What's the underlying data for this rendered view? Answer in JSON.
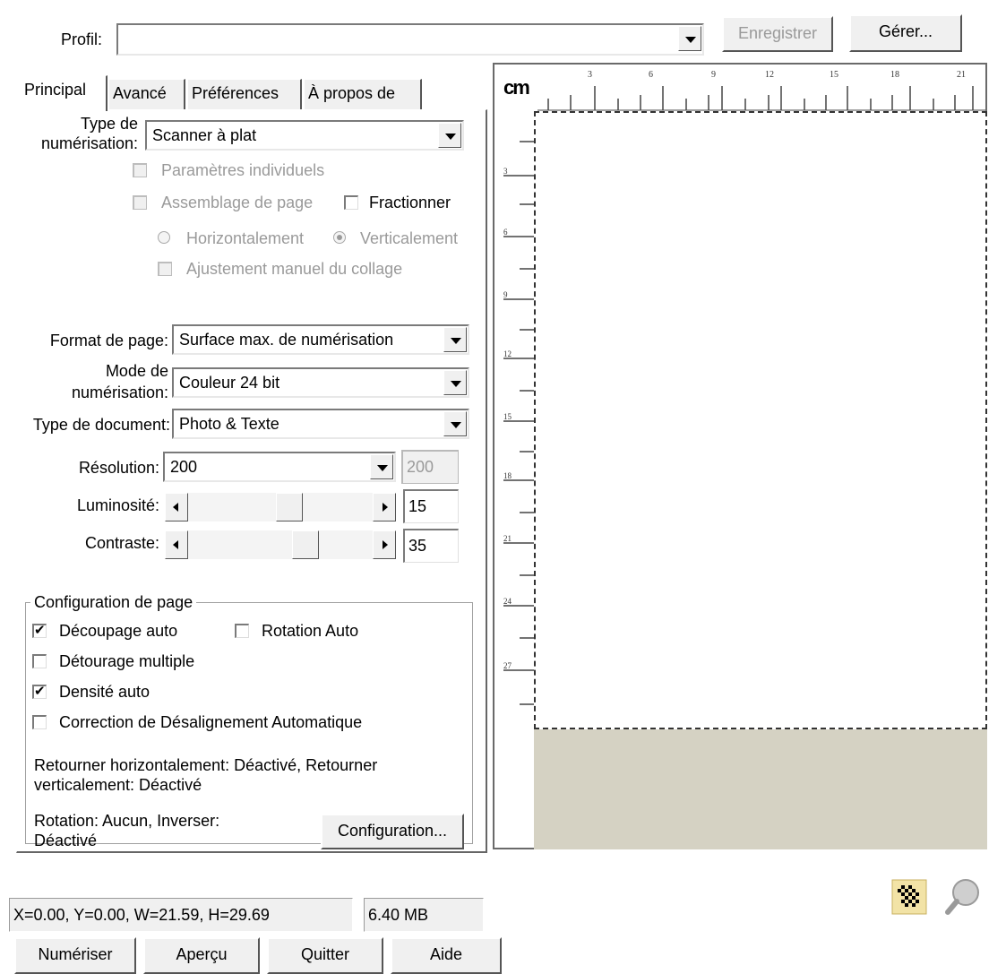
{
  "profile": {
    "label": "Profil:",
    "value": "",
    "save_button": "Enregistrer",
    "manage_button": "Gérer..."
  },
  "tabs": [
    {
      "label": "Principal"
    },
    {
      "label": "Avancé"
    },
    {
      "label": "Préférences"
    },
    {
      "label": "À propos de"
    }
  ],
  "main": {
    "scan_type": {
      "label_line1": "Type de",
      "label_line2": "numérisation:",
      "value": "Scanner à plat"
    },
    "individual_params": {
      "label": "Paramètres individuels",
      "checked": false,
      "enabled": false
    },
    "page_assembly": {
      "label": "Assemblage de page",
      "checked": false,
      "enabled": false
    },
    "split": {
      "label": "Fractionner",
      "checked": false
    },
    "horizontal": {
      "label": "Horizontalement",
      "selected": false
    },
    "vertical": {
      "label": "Verticalement",
      "selected": true
    },
    "manual_adjust": {
      "label": "Ajustement manuel du collage",
      "checked": false
    },
    "page_format": {
      "label": "Format de page:",
      "value": "Surface max. de numérisation"
    },
    "scan_mode": {
      "label_line1": "Mode de",
      "label_line2": "numérisation:",
      "value": "Couleur 24 bit"
    },
    "doc_type": {
      "label": "Type de document:",
      "value": "Photo & Texte"
    },
    "resolution": {
      "label": "Résolution:",
      "value": "200",
      "custom_value": "200"
    },
    "brightness": {
      "label": "Luminosité:",
      "value": "15",
      "level": 15
    },
    "contrast": {
      "label": "Contraste:",
      "value": "35",
      "level": 35
    }
  },
  "page_config": {
    "title": "Configuration de page",
    "auto_crop": {
      "label": "Découpage auto",
      "checked": true
    },
    "auto_rotate": {
      "label": "Rotation Auto",
      "checked": false
    },
    "multi_crop": {
      "label": "Détourage multiple",
      "checked": false
    },
    "auto_density": {
      "label": "Densité auto",
      "checked": true
    },
    "deskew": {
      "label": "Correction de Désalignement Automatique",
      "checked": false
    },
    "flip_info_line1": "Retourner horizontalement: Déactivé, Retourner",
    "flip_info_line2": "verticalement: Déactivé",
    "rotation_info_line1": "Rotation: Aucun, Inverser:",
    "rotation_info_line2": "Déactivé",
    "config_button": "Configuration..."
  },
  "preview": {
    "unit": "cm",
    "h_ticks": [
      "3",
      "6",
      "9",
      "12",
      "15",
      "18",
      "21"
    ],
    "v_ticks": [
      "3",
      "6",
      "9",
      "12",
      "15",
      "18",
      "21",
      "24",
      "27"
    ],
    "bed_color": "#d5d2c3"
  },
  "status": {
    "coords": "X=0.00, Y=0.00, W=21.59, H=29.69",
    "size": "6.40 MB"
  },
  "buttons": {
    "scan": "Numériser",
    "preview": "Aperçu",
    "quit": "Quitter",
    "help": "Aide"
  },
  "icons": {
    "left": "checkered-hand-icon",
    "right": "magnifier-icon"
  }
}
